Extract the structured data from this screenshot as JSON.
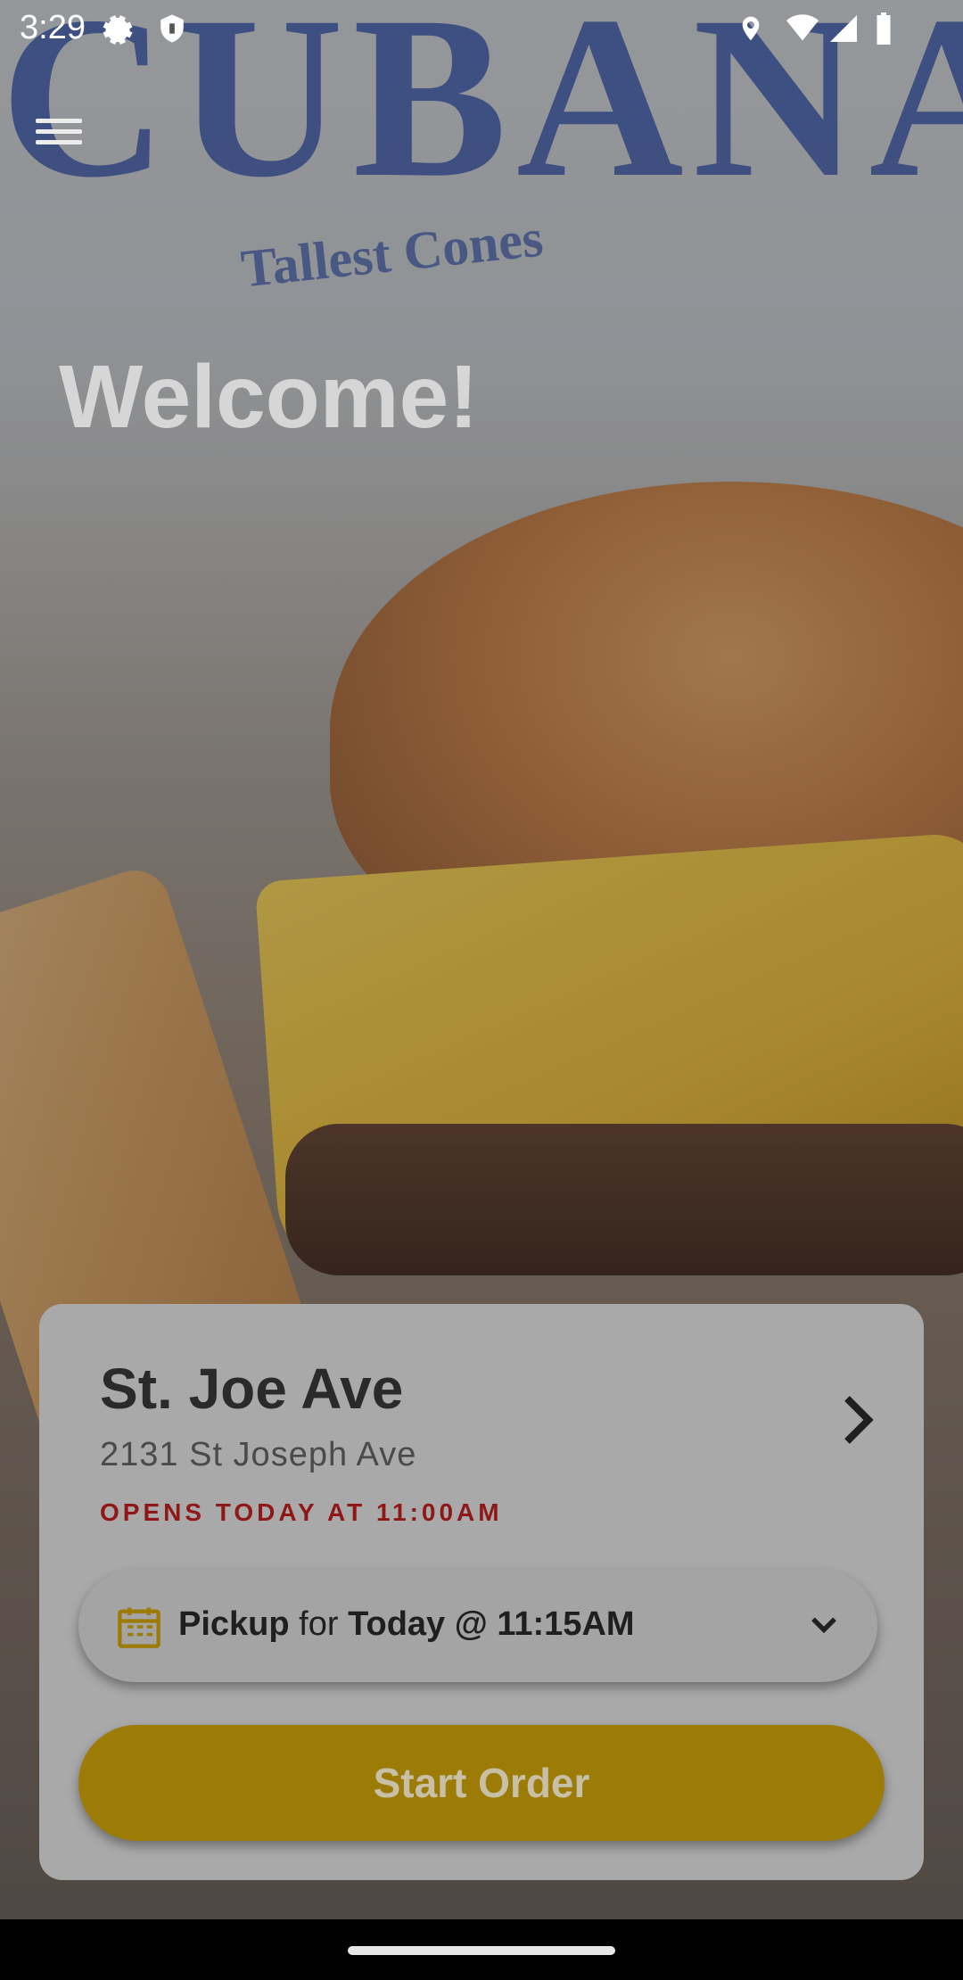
{
  "status_bar": {
    "time": "3:29",
    "icons": [
      "gear-icon",
      "shield-icon",
      "location-pin-icon",
      "wifi-icon",
      "signal-icon",
      "battery-icon"
    ]
  },
  "header": {
    "menu_icon": "menu-icon",
    "welcome": "Welcome!"
  },
  "store": {
    "name": "St. Joe Ave",
    "address": "2131 St Joseph Ave",
    "hours": "OPENS TODAY AT 11:00AM"
  },
  "pickup": {
    "mode": "Pickup",
    "connector": "for",
    "time": "Today @ 11:15AM"
  },
  "actions": {
    "start_order": "Start Order"
  },
  "colors": {
    "accent_button": "#9c7b06",
    "hours_text": "#8f1717",
    "card_bg": "#a9a9a9"
  }
}
